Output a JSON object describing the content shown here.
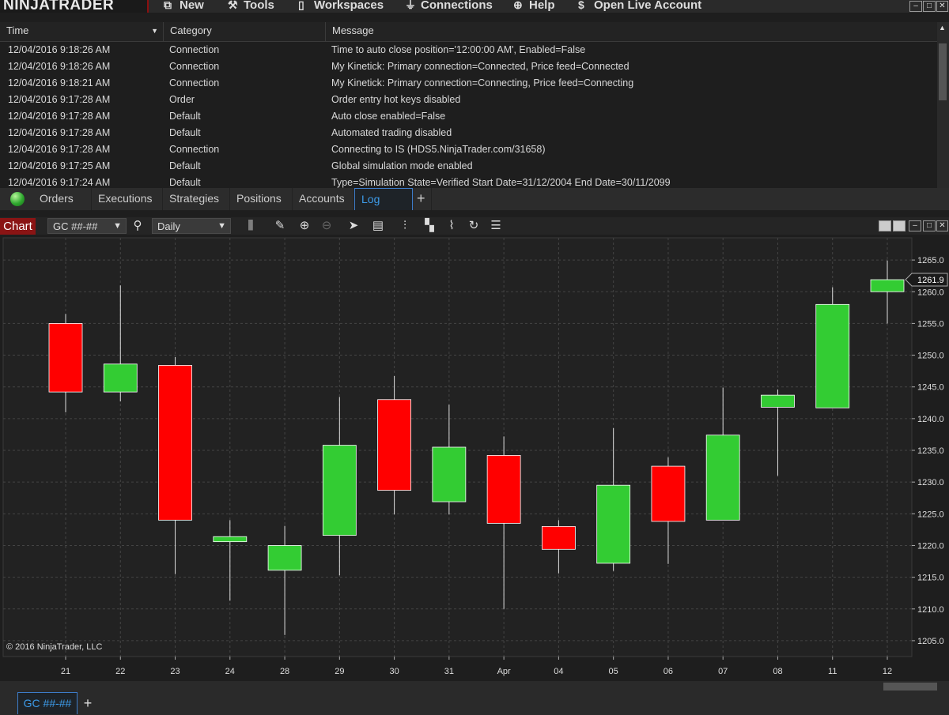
{
  "app": {
    "logo": "NINJATRADER",
    "menu": [
      {
        "label": "New",
        "icon": "new-window-icon"
      },
      {
        "label": "Tools",
        "icon": "tools-icon"
      },
      {
        "label": "Workspaces",
        "icon": "workspace-icon"
      },
      {
        "label": "Connections",
        "icon": "plug-icon"
      },
      {
        "label": "Help",
        "icon": "help-icon"
      },
      {
        "label": "Open Live Account",
        "icon": "dollar-icon"
      }
    ]
  },
  "log": {
    "columns": [
      "Time",
      "Category",
      "Message"
    ],
    "rows": [
      {
        "time": "12/04/2016 9:18:26 AM",
        "category": "Connection",
        "message": "Time to auto close position='12:00:00 AM', Enabled=False"
      },
      {
        "time": "12/04/2016 9:18:26 AM",
        "category": "Connection",
        "message": "My Kinetick: Primary connection=Connected, Price feed=Connected"
      },
      {
        "time": "12/04/2016 9:18:21 AM",
        "category": "Connection",
        "message": "My Kinetick: Primary connection=Connecting, Price feed=Connecting"
      },
      {
        "time": "12/04/2016 9:17:28 AM",
        "category": "Order",
        "message": "Order entry hot keys disabled"
      },
      {
        "time": "12/04/2016 9:17:28 AM",
        "category": "Default",
        "message": "Auto close enabled=False"
      },
      {
        "time": "12/04/2016 9:17:28 AM",
        "category": "Default",
        "message": "Automated trading disabled"
      },
      {
        "time": "12/04/2016 9:17:28 AM",
        "category": "Connection",
        "message": "Connecting to IS (HDS5.NinjaTrader.com/31658)"
      },
      {
        "time": "12/04/2016 9:17:25 AM",
        "category": "Default",
        "message": "Global simulation mode enabled"
      },
      {
        "time": "12/04/2016 9:17:24 AM",
        "category": "Default",
        "message": "Type=Simulation State=Verified Start Date=31/12/2004 End Date=30/11/2099"
      }
    ]
  },
  "tabs": {
    "items": [
      "Orders",
      "Executions",
      "Strategies",
      "Positions",
      "Accounts",
      "Log"
    ],
    "active": "Log",
    "add_label": "+"
  },
  "chart_window": {
    "title": "Chart",
    "instrument": "GC ##-##",
    "interval": "Daily",
    "copyright": "© 2016 NinjaTrader, LLC",
    "current_price": "1261.9",
    "bottom_tab": "GC ##-##",
    "bottom_add": "+"
  },
  "chart_data": {
    "type": "candlestick",
    "ylim": [
      1202.5,
      1268.5
    ],
    "y_ticks": [
      1205.0,
      1210.0,
      1215.0,
      1220.0,
      1225.0,
      1230.0,
      1235.0,
      1240.0,
      1245.0,
      1250.0,
      1255.0,
      1260.0,
      1265.0
    ],
    "up_color": "#33cc33",
    "down_color": "#ff0000",
    "candles": [
      {
        "x": "21",
        "open": 1255.0,
        "high": 1256.5,
        "low": 1241.0,
        "close": 1244.2
      },
      {
        "x": "22",
        "open": 1244.2,
        "high": 1261.0,
        "low": 1242.7,
        "close": 1248.6
      },
      {
        "x": "23",
        "open": 1248.4,
        "high": 1249.7,
        "low": 1215.5,
        "close": 1224.0
      },
      {
        "x": "24",
        "open": 1220.6,
        "high": 1224.0,
        "low": 1211.3,
        "close": 1221.4
      },
      {
        "x": "28",
        "open": 1216.1,
        "high": 1223.1,
        "low": 1205.9,
        "close": 1220.0
      },
      {
        "x": "29",
        "open": 1221.6,
        "high": 1243.4,
        "low": 1215.3,
        "close": 1235.8
      },
      {
        "x": "30",
        "open": 1243.0,
        "high": 1246.7,
        "low": 1224.9,
        "close": 1228.7
      },
      {
        "x": "31",
        "open": 1226.9,
        "high": 1242.2,
        "low": 1224.9,
        "close": 1235.5
      },
      {
        "x": "Apr",
        "open": 1234.2,
        "high": 1237.2,
        "low": 1210.0,
        "close": 1223.5
      },
      {
        "x": "04",
        "open": 1223.0,
        "high": 1224.0,
        "low": 1215.6,
        "close": 1219.4
      },
      {
        "x": "05",
        "open": 1217.2,
        "high": 1238.5,
        "low": 1216.0,
        "close": 1229.5
      },
      {
        "x": "06",
        "open": 1232.5,
        "high": 1233.9,
        "low": 1217.1,
        "close": 1223.8
      },
      {
        "x": "07",
        "open": 1224.0,
        "high": 1244.9,
        "low": 1224.0,
        "close": 1237.4
      },
      {
        "x": "08",
        "open": 1241.8,
        "high": 1244.6,
        "low": 1231.0,
        "close": 1243.7
      },
      {
        "x": "11",
        "open": 1241.7,
        "high": 1260.7,
        "low": 1241.7,
        "close": 1258.0
      },
      {
        "x": "12",
        "open": 1260.0,
        "high": 1264.9,
        "low": 1255.0,
        "close": 1261.9
      }
    ]
  }
}
